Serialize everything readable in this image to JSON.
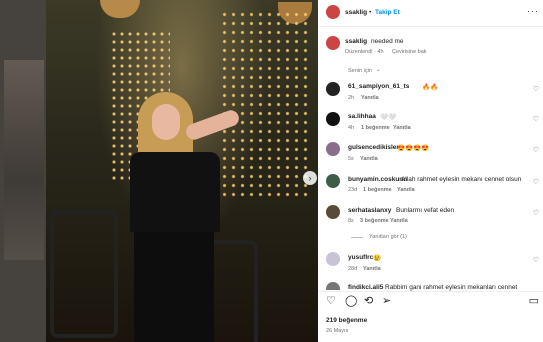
{
  "post": {
    "author": "ssaklig",
    "follow_label": "Takip Et",
    "caption_user": "ssaklig",
    "caption_text": "needed me",
    "caption_meta": "Düzenlendi · 4h",
    "translate_label": "Çevirisine bak",
    "section_label": "Senin için",
    "likes": "219 beğenme",
    "date": "26 Mayıs"
  },
  "comments": [
    {
      "user": "61_sampiyon_61_ts",
      "text": "🔥🔥",
      "time": "2h",
      "likes": "",
      "reply": "Yanıtla"
    },
    {
      "user": "sa.lihhaa",
      "text": "🤍🤍",
      "time": "4h",
      "likes": "1 beğenme",
      "reply": "Yanıtla"
    },
    {
      "user": "gulsencedikisler",
      "text": "😍😍😍😍",
      "time": "5s",
      "likes": "",
      "reply": "Yanıtla"
    },
    {
      "user": "bunyamin.coskunn",
      "text": "Allah rahmet eylesin mekanı cennet olsun",
      "time": "23d",
      "likes": "1 beğenme",
      "reply": "Yanıtla"
    },
    {
      "user": "serhataslanxy",
      "text": "Bunlarmı vefat eden",
      "time": "8s",
      "likes": "3 beğenme",
      "reply": "Yanıtla",
      "view_replies": "Yanıtları gör (1)"
    },
    {
      "user": "yusuflrc",
      "text": "😢",
      "time": "28d",
      "likes": "",
      "reply": "Yanıtla"
    },
    {
      "user": "findikci.ali5",
      "text": "Rabbim gani rahmet eylesin mekanları cennet",
      "time": "",
      "likes": "",
      "reply": ""
    }
  ],
  "icons": {
    "more": "more-horizontal-icon",
    "like": "heart-icon",
    "comment": "comment-icon",
    "share": "share-icon",
    "save": "bookmark-icon",
    "next": "chevron-right-icon"
  }
}
